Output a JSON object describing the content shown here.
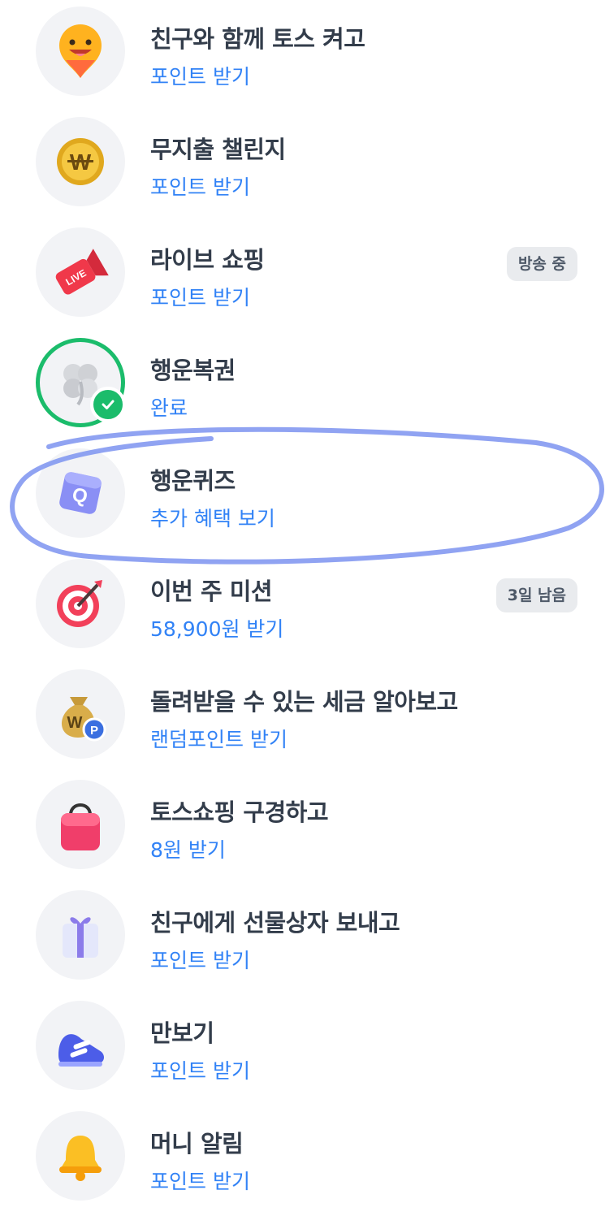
{
  "items": [
    {
      "title": "친구와 함께 토스 켜고",
      "sub": "포인트 받기",
      "icon": "smiley-pin-icon"
    },
    {
      "title": "무지출 챌린지",
      "sub": "포인트 받기",
      "icon": "won-coin-icon"
    },
    {
      "title": "라이브 쇼핑",
      "sub": "포인트 받기",
      "icon": "live-megaphone-icon",
      "badge": "방송 중"
    },
    {
      "title": "행운복권",
      "sub": "완료",
      "icon": "clover-icon",
      "completed": true
    },
    {
      "title": "행운퀴즈",
      "sub": "추가 혜택 보기",
      "icon": "quiz-cube-icon"
    },
    {
      "title": "이번 주 미션",
      "sub": "58,900원 받기",
      "icon": "target-dart-icon",
      "badge": "3일 남음"
    },
    {
      "title": "돌려받을 수 있는 세금 알아보고",
      "sub": "랜덤포인트 받기",
      "icon": "money-bag-icon"
    },
    {
      "title": "토스쇼핑 구경하고",
      "sub": "8원 받기",
      "icon": "shopping-bag-icon"
    },
    {
      "title": "친구에게 선물상자 보내고",
      "sub": "포인트 받기",
      "icon": "gift-box-icon"
    },
    {
      "title": "만보기",
      "sub": "포인트 받기",
      "icon": "sneaker-icon"
    },
    {
      "title": "머니 알림",
      "sub": "포인트 받기",
      "icon": "bell-icon"
    }
  ],
  "icon_glyphs": {
    "won": "W",
    "live": "LIVE",
    "quiz": "Q",
    "point": "P"
  },
  "colors": {
    "title": "#333d4b",
    "link": "#3182f6",
    "completed_ring": "#1bbc6b",
    "badge_bg": "#e9ebee",
    "icon_bg": "#f2f3f6",
    "highlight_stroke": "#7c93f0"
  }
}
